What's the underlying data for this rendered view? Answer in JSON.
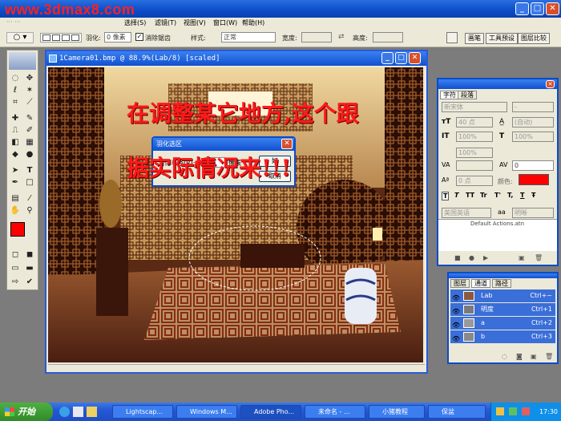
{
  "app": {
    "watermark": "www.3dmax8.com"
  },
  "window_buttons": {
    "minimize": "_",
    "maximize": "□",
    "close": "✕"
  },
  "menubar": {
    "items": [
      "选择(S)",
      "滤镜(T)",
      "视图(V)",
      "窗口(W)",
      "帮助(H)"
    ]
  },
  "options": {
    "feather_label": "羽化:",
    "feather_value": "0 像素",
    "antialias_label": "消除锯齿",
    "antialias_checked": true,
    "style_label": "样式:",
    "style_value": "正常",
    "width_label": "宽度:",
    "height_label": "高度:",
    "tabs": [
      "画笔",
      "工具预设",
      "图层比较"
    ]
  },
  "document": {
    "title": "1Camera01.bmp @ 88.9%(Lab/8) [scaled]"
  },
  "overlay_text": {
    "line1": "在调整某它地方,这个跟",
    "line2": "据实际情况来!!!"
  },
  "dialog": {
    "title": "羽化选区",
    "field_label": "羽化半径(R):",
    "field_value": "0",
    "unit": "像素",
    "ok_label": "好",
    "cancel_label": "取消",
    "close": "✕"
  },
  "colors": {
    "foreground": "#ff0000",
    "background": "#000000",
    "text_color_swatch": "#ff0000",
    "accent": "#0b4cc8"
  },
  "char_panel": {
    "tabs": [
      "字符",
      "段落"
    ],
    "font_family": "新宋体",
    "font_style": "-",
    "font_size": "40 点",
    "leading": "(自动)",
    "vertical_scale": "100%",
    "horizontal_scale": "100%",
    "tracking_scale": "100%",
    "kerning": "0",
    "baseline": "0 点",
    "color_label": "颜色:",
    "language": "美国英语",
    "aa_label": "aa",
    "antialias": "明晰",
    "style_buttons": [
      "T",
      "T",
      "TT",
      "Tr",
      "T'",
      "T,",
      "T",
      "Ŧ"
    ],
    "action_text": "Default Actions.atn"
  },
  "channels": {
    "tabs": [
      "图层",
      "通道",
      "路径"
    ],
    "rows": [
      {
        "name": "Lab",
        "shortcut": "Ctrl+~"
      },
      {
        "name": "明度",
        "shortcut": "Ctrl+1"
      },
      {
        "name": "a",
        "shortcut": "Ctrl+2"
      },
      {
        "name": "b",
        "shortcut": "Ctrl+3"
      }
    ]
  },
  "taskbar": {
    "start": "开始",
    "tasks": [
      "Lightscap...",
      "Windows M...",
      "Adobe Pho...",
      "未命名 - ...",
      "小猪教程",
      "保盆"
    ],
    "clock": "17:30"
  }
}
